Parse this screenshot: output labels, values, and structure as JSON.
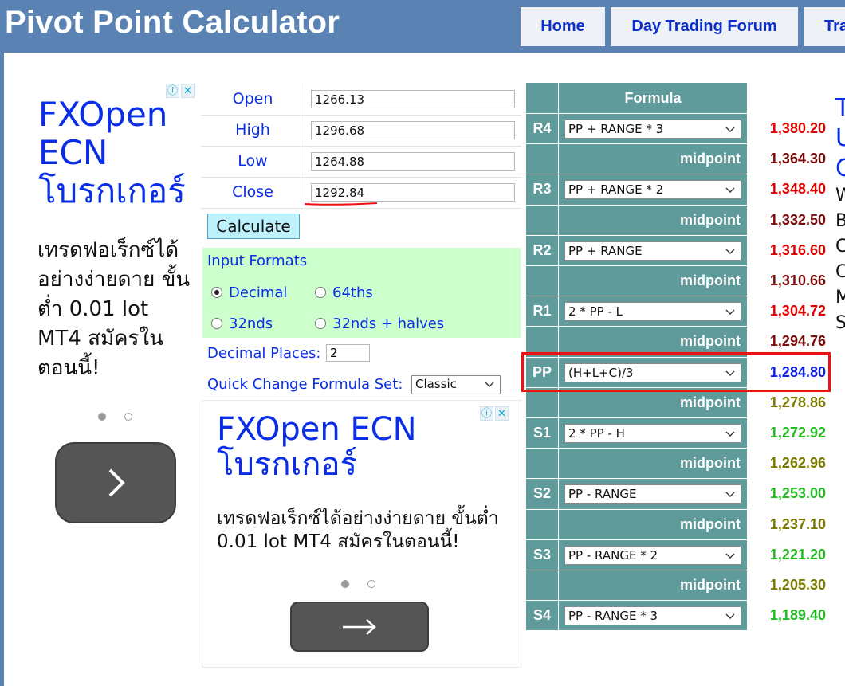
{
  "header": {
    "title": "Pivot Point Calculator",
    "nav": [
      "Home",
      "Day Trading Forum",
      "Trading"
    ]
  },
  "ad_left": {
    "headline": "FXOpen ECN โบรกเกอร์",
    "body": "เทรดฟอเร็กซ์ได้อย่างง่ายดาย ขั้นต่ำ 0.01 lot MT4 สมัครในตอนนี้!",
    "icons": [
      "adchoices-icon",
      "close-icon",
      "chevron-right-icon"
    ]
  },
  "ad_center": {
    "headline": "FXOpen ECN โบรกเกอร์",
    "body": "เทรดฟอเร็กซ์ได้อย่างง่ายดาย ขั้นต่ำ 0.01 lot MT4 สมัครในตอนนี้!",
    "icons": [
      "adchoices-icon",
      "close-icon",
      "arrow-right-icon"
    ]
  },
  "inputs": [
    {
      "label": "Open",
      "value": "1266.13"
    },
    {
      "label": "High",
      "value": "1296.68"
    },
    {
      "label": "Low",
      "value": "1264.88"
    },
    {
      "label": "Close",
      "value": "1292.84"
    }
  ],
  "calculate_label": "Calculate",
  "formats": {
    "title": "Input Formats",
    "options": [
      {
        "label": "Decimal",
        "checked": true
      },
      {
        "label": "64ths",
        "checked": false
      },
      {
        "label": "32nds",
        "checked": false
      },
      {
        "label": "32nds + halves",
        "checked": false
      }
    ]
  },
  "decimal_places": {
    "label": "Decimal Places:",
    "value": "2"
  },
  "quick_change": {
    "label": "Quick Change Formula Set:",
    "value": "Classic"
  },
  "results": {
    "header": "Formula",
    "midpoint_label": "midpoint",
    "rows": [
      {
        "type": "level",
        "level": "R4",
        "formula": "PP + RANGE * 3",
        "value": "1,380.20",
        "color": "#e00000"
      },
      {
        "type": "mid",
        "value": "1,364.30",
        "color": "#7a0b0b"
      },
      {
        "type": "level",
        "level": "R3",
        "formula": "PP + RANGE * 2",
        "value": "1,348.40",
        "color": "#e00000"
      },
      {
        "type": "mid",
        "value": "1,332.50",
        "color": "#7a0b0b"
      },
      {
        "type": "level",
        "level": "R2",
        "formula": "PP + RANGE",
        "value": "1,316.60",
        "color": "#e00000"
      },
      {
        "type": "mid",
        "value": "1,310.66",
        "color": "#7a0b0b"
      },
      {
        "type": "level",
        "level": "R1",
        "formula": "2 * PP - L",
        "value": "1,304.72",
        "color": "#e00000"
      },
      {
        "type": "mid",
        "value": "1,294.76",
        "color": "#7a0b0b"
      },
      {
        "type": "level",
        "level": "PP",
        "formula": "(H+L+C)/3",
        "value": "1,284.80",
        "color": "#1020e0"
      },
      {
        "type": "mid",
        "value": "1,278.86",
        "color": "#7a7a00"
      },
      {
        "type": "level",
        "level": "S1",
        "formula": "2 * PP - H",
        "value": "1,272.92",
        "color": "#22bb22"
      },
      {
        "type": "mid",
        "value": "1,262.96",
        "color": "#7a7a00"
      },
      {
        "type": "level",
        "level": "S2",
        "formula": "PP - RANGE",
        "value": "1,253.00",
        "color": "#22bb22"
      },
      {
        "type": "mid",
        "value": "1,237.10",
        "color": "#7a7a00"
      },
      {
        "type": "level",
        "level": "S3",
        "formula": "PP - RANGE * 2",
        "value": "1,221.20",
        "color": "#22bb22"
      },
      {
        "type": "mid",
        "value": "1,205.30",
        "color": "#7a7a00"
      },
      {
        "type": "level",
        "level": "S4",
        "formula": "PP - RANGE * 3",
        "value": "1,189.40",
        "color": "#22bb22"
      }
    ]
  },
  "right_partial_text": [
    "T",
    "U",
    "C",
    "W",
    "B",
    "C",
    "C",
    "M",
    "S"
  ]
}
